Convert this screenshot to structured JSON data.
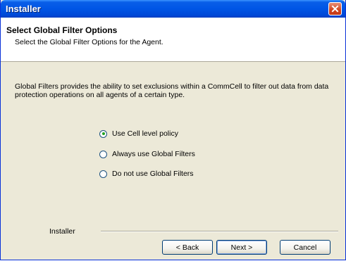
{
  "window": {
    "title": "Installer"
  },
  "header": {
    "title": "Select Global Filter Options",
    "subtitle": "Select the Global Filter Options for the Agent."
  },
  "main": {
    "description": "Global Filters provides the ability to set exclusions within a CommCell to filter out data from data protection operations on all agents of a certain type.",
    "options": [
      {
        "label": "Use Cell level policy",
        "selected": true
      },
      {
        "label": "Always use Global Filters",
        "selected": false
      },
      {
        "label": "Do not use Global Filters",
        "selected": false
      }
    ]
  },
  "footer": {
    "label": "Installer",
    "back_label": "< Back",
    "next_label": "Next >",
    "cancel_label": "Cancel"
  }
}
